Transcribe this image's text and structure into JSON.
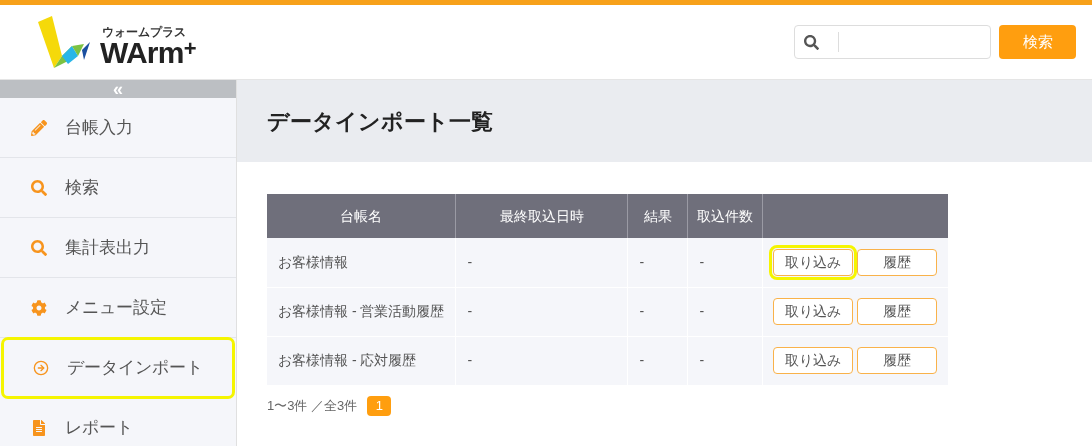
{
  "logo": {
    "tagline": "ウォームプラス",
    "wordmark": "WArm",
    "plus": "+"
  },
  "header": {
    "search_button": "検索"
  },
  "sidebar": {
    "collapse": "«",
    "items": [
      {
        "label": "台帳入力",
        "kind": "pencil",
        "highlighted": false
      },
      {
        "label": "検索",
        "kind": "search",
        "highlighted": false
      },
      {
        "label": "集計表出力",
        "kind": "search",
        "highlighted": false
      },
      {
        "label": "メニュー設定",
        "kind": "gear",
        "highlighted": false
      },
      {
        "label": "データインポート",
        "kind": "import",
        "highlighted": true
      },
      {
        "label": "レポート",
        "kind": "file",
        "highlighted": false
      }
    ]
  },
  "page_title": "データインポート一覧",
  "table": {
    "columns": [
      "台帳名",
      "最終取込日時",
      "結果",
      "取込件数"
    ],
    "rows": [
      {
        "cells": [
          "お客様情報",
          "-",
          "-",
          "-"
        ],
        "import_button": "取り込み",
        "history_button": "履歴",
        "import_highlighted": true
      },
      {
        "cells": [
          "お客様情報 - 営業活動履歴",
          "-",
          "-",
          "-"
        ],
        "import_button": "取り込み",
        "history_button": "履歴",
        "import_highlighted": false
      },
      {
        "cells": [
          "お客様情報 - 応対履歴",
          "-",
          "-",
          "-"
        ],
        "import_button": "取り込み",
        "history_button": "履歴",
        "import_highlighted": false
      }
    ]
  },
  "pagination": {
    "summary": "1〜3件 ／全3件",
    "pages": [
      {
        "label": "1",
        "selected": true
      }
    ]
  }
}
